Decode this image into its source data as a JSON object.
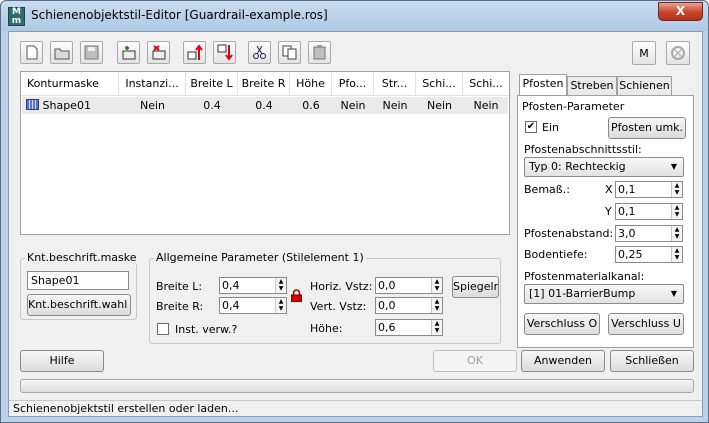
{
  "window": {
    "app_icon_text": "M",
    "title": "Schienenobjektstil-Editor [Guardrail-example.ros]",
    "close_label": "X"
  },
  "toolbar": {
    "icons": [
      "new-file-icon",
      "open-folder-icon",
      "save-icon",
      "add-layer-icon",
      "delete-layer-icon",
      "move-up-icon",
      "move-down-icon",
      "cut-icon",
      "copy-icon",
      "paste-icon"
    ],
    "m_button": "M"
  },
  "list": {
    "columns": [
      "Konturmaske",
      "Instanzi...",
      "Breite L",
      "Breite R",
      "Höhe",
      "Pfo...",
      "Str...",
      "Schi...",
      "Schi..."
    ],
    "rows": [
      [
        "Shape01",
        "Nein",
        "0.4",
        "0.4",
        "0.6",
        "Nein",
        "Nein",
        "Nein",
        "Nein"
      ]
    ]
  },
  "shape_label_group": {
    "title": "Knt.beschrift.maske",
    "value": "Shape01",
    "button": "Knt.beschrift.wahl >"
  },
  "general_params": {
    "title": "Allgemeine Parameter (Stilelement 1)",
    "width_l_label": "Breite L:",
    "width_l_value": "0,4",
    "width_r_label": "Breite R:",
    "width_r_value": "0,4",
    "instance_label": "Inst. verw.?",
    "horiz_label": "Horiz. Vstz:",
    "horiz_value": "0,0",
    "vert_label": "Vert. Vstz:",
    "vert_value": "0,0",
    "height_label": "Höhe:",
    "height_value": "0,6",
    "mirror_button": "Spiegeln"
  },
  "tabs": [
    "Pfosten",
    "Streben",
    "Schienen"
  ],
  "posts": {
    "section_title": "Pfosten-Parameter",
    "enabled_label": "Ein",
    "enabled": true,
    "switch_button": "Pfosten umk.",
    "style_label": "Pfostenabschnittsstil:",
    "style_value": "Typ 0: Rechteckig",
    "dimension_label": "Bemaß.:",
    "x_label": "X",
    "x_value": "0,1",
    "y_label": "Y",
    "y_value": "0,1",
    "spacing_label": "Pfostenabstand:",
    "spacing_value": "3,0",
    "depth_label": "Bodentiefe:",
    "depth_value": "0,25",
    "material_label": "Pfostenmaterialkanal:",
    "material_value": "[1] 01-BarrierBump",
    "cap_o_button": "Verschluss O",
    "cap_u_button": "Verschluss U"
  },
  "footer": {
    "help": "Hilfe",
    "ok": "OK",
    "apply": "Anwenden",
    "close": "Schließen"
  },
  "status_text": "Schienenobjektstil erstellen oder laden..."
}
